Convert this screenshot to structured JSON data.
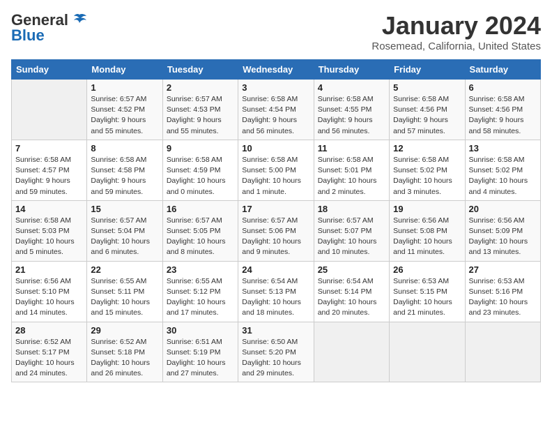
{
  "header": {
    "logo_general": "General",
    "logo_blue": "Blue",
    "month": "January 2024",
    "location": "Rosemead, California, United States"
  },
  "weekdays": [
    "Sunday",
    "Monday",
    "Tuesday",
    "Wednesday",
    "Thursday",
    "Friday",
    "Saturday"
  ],
  "weeks": [
    [
      {
        "day": "",
        "info": ""
      },
      {
        "day": "1",
        "info": "Sunrise: 6:57 AM\nSunset: 4:52 PM\nDaylight: 9 hours\nand 55 minutes."
      },
      {
        "day": "2",
        "info": "Sunrise: 6:57 AM\nSunset: 4:53 PM\nDaylight: 9 hours\nand 55 minutes."
      },
      {
        "day": "3",
        "info": "Sunrise: 6:58 AM\nSunset: 4:54 PM\nDaylight: 9 hours\nand 56 minutes."
      },
      {
        "day": "4",
        "info": "Sunrise: 6:58 AM\nSunset: 4:55 PM\nDaylight: 9 hours\nand 56 minutes."
      },
      {
        "day": "5",
        "info": "Sunrise: 6:58 AM\nSunset: 4:56 PM\nDaylight: 9 hours\nand 57 minutes."
      },
      {
        "day": "6",
        "info": "Sunrise: 6:58 AM\nSunset: 4:56 PM\nDaylight: 9 hours\nand 58 minutes."
      }
    ],
    [
      {
        "day": "7",
        "info": "Sunrise: 6:58 AM\nSunset: 4:57 PM\nDaylight: 9 hours\nand 59 minutes."
      },
      {
        "day": "8",
        "info": "Sunrise: 6:58 AM\nSunset: 4:58 PM\nDaylight: 9 hours\nand 59 minutes."
      },
      {
        "day": "9",
        "info": "Sunrise: 6:58 AM\nSunset: 4:59 PM\nDaylight: 10 hours\nand 0 minutes."
      },
      {
        "day": "10",
        "info": "Sunrise: 6:58 AM\nSunset: 5:00 PM\nDaylight: 10 hours\nand 1 minute."
      },
      {
        "day": "11",
        "info": "Sunrise: 6:58 AM\nSunset: 5:01 PM\nDaylight: 10 hours\nand 2 minutes."
      },
      {
        "day": "12",
        "info": "Sunrise: 6:58 AM\nSunset: 5:02 PM\nDaylight: 10 hours\nand 3 minutes."
      },
      {
        "day": "13",
        "info": "Sunrise: 6:58 AM\nSunset: 5:02 PM\nDaylight: 10 hours\nand 4 minutes."
      }
    ],
    [
      {
        "day": "14",
        "info": "Sunrise: 6:58 AM\nSunset: 5:03 PM\nDaylight: 10 hours\nand 5 minutes."
      },
      {
        "day": "15",
        "info": "Sunrise: 6:57 AM\nSunset: 5:04 PM\nDaylight: 10 hours\nand 6 minutes."
      },
      {
        "day": "16",
        "info": "Sunrise: 6:57 AM\nSunset: 5:05 PM\nDaylight: 10 hours\nand 8 minutes."
      },
      {
        "day": "17",
        "info": "Sunrise: 6:57 AM\nSunset: 5:06 PM\nDaylight: 10 hours\nand 9 minutes."
      },
      {
        "day": "18",
        "info": "Sunrise: 6:57 AM\nSunset: 5:07 PM\nDaylight: 10 hours\nand 10 minutes."
      },
      {
        "day": "19",
        "info": "Sunrise: 6:56 AM\nSunset: 5:08 PM\nDaylight: 10 hours\nand 11 minutes."
      },
      {
        "day": "20",
        "info": "Sunrise: 6:56 AM\nSunset: 5:09 PM\nDaylight: 10 hours\nand 13 minutes."
      }
    ],
    [
      {
        "day": "21",
        "info": "Sunrise: 6:56 AM\nSunset: 5:10 PM\nDaylight: 10 hours\nand 14 minutes."
      },
      {
        "day": "22",
        "info": "Sunrise: 6:55 AM\nSunset: 5:11 PM\nDaylight: 10 hours\nand 15 minutes."
      },
      {
        "day": "23",
        "info": "Sunrise: 6:55 AM\nSunset: 5:12 PM\nDaylight: 10 hours\nand 17 minutes."
      },
      {
        "day": "24",
        "info": "Sunrise: 6:54 AM\nSunset: 5:13 PM\nDaylight: 10 hours\nand 18 minutes."
      },
      {
        "day": "25",
        "info": "Sunrise: 6:54 AM\nSunset: 5:14 PM\nDaylight: 10 hours\nand 20 minutes."
      },
      {
        "day": "26",
        "info": "Sunrise: 6:53 AM\nSunset: 5:15 PM\nDaylight: 10 hours\nand 21 minutes."
      },
      {
        "day": "27",
        "info": "Sunrise: 6:53 AM\nSunset: 5:16 PM\nDaylight: 10 hours\nand 23 minutes."
      }
    ],
    [
      {
        "day": "28",
        "info": "Sunrise: 6:52 AM\nSunset: 5:17 PM\nDaylight: 10 hours\nand 24 minutes."
      },
      {
        "day": "29",
        "info": "Sunrise: 6:52 AM\nSunset: 5:18 PM\nDaylight: 10 hours\nand 26 minutes."
      },
      {
        "day": "30",
        "info": "Sunrise: 6:51 AM\nSunset: 5:19 PM\nDaylight: 10 hours\nand 27 minutes."
      },
      {
        "day": "31",
        "info": "Sunrise: 6:50 AM\nSunset: 5:20 PM\nDaylight: 10 hours\nand 29 minutes."
      },
      {
        "day": "",
        "info": ""
      },
      {
        "day": "",
        "info": ""
      },
      {
        "day": "",
        "info": ""
      }
    ]
  ]
}
